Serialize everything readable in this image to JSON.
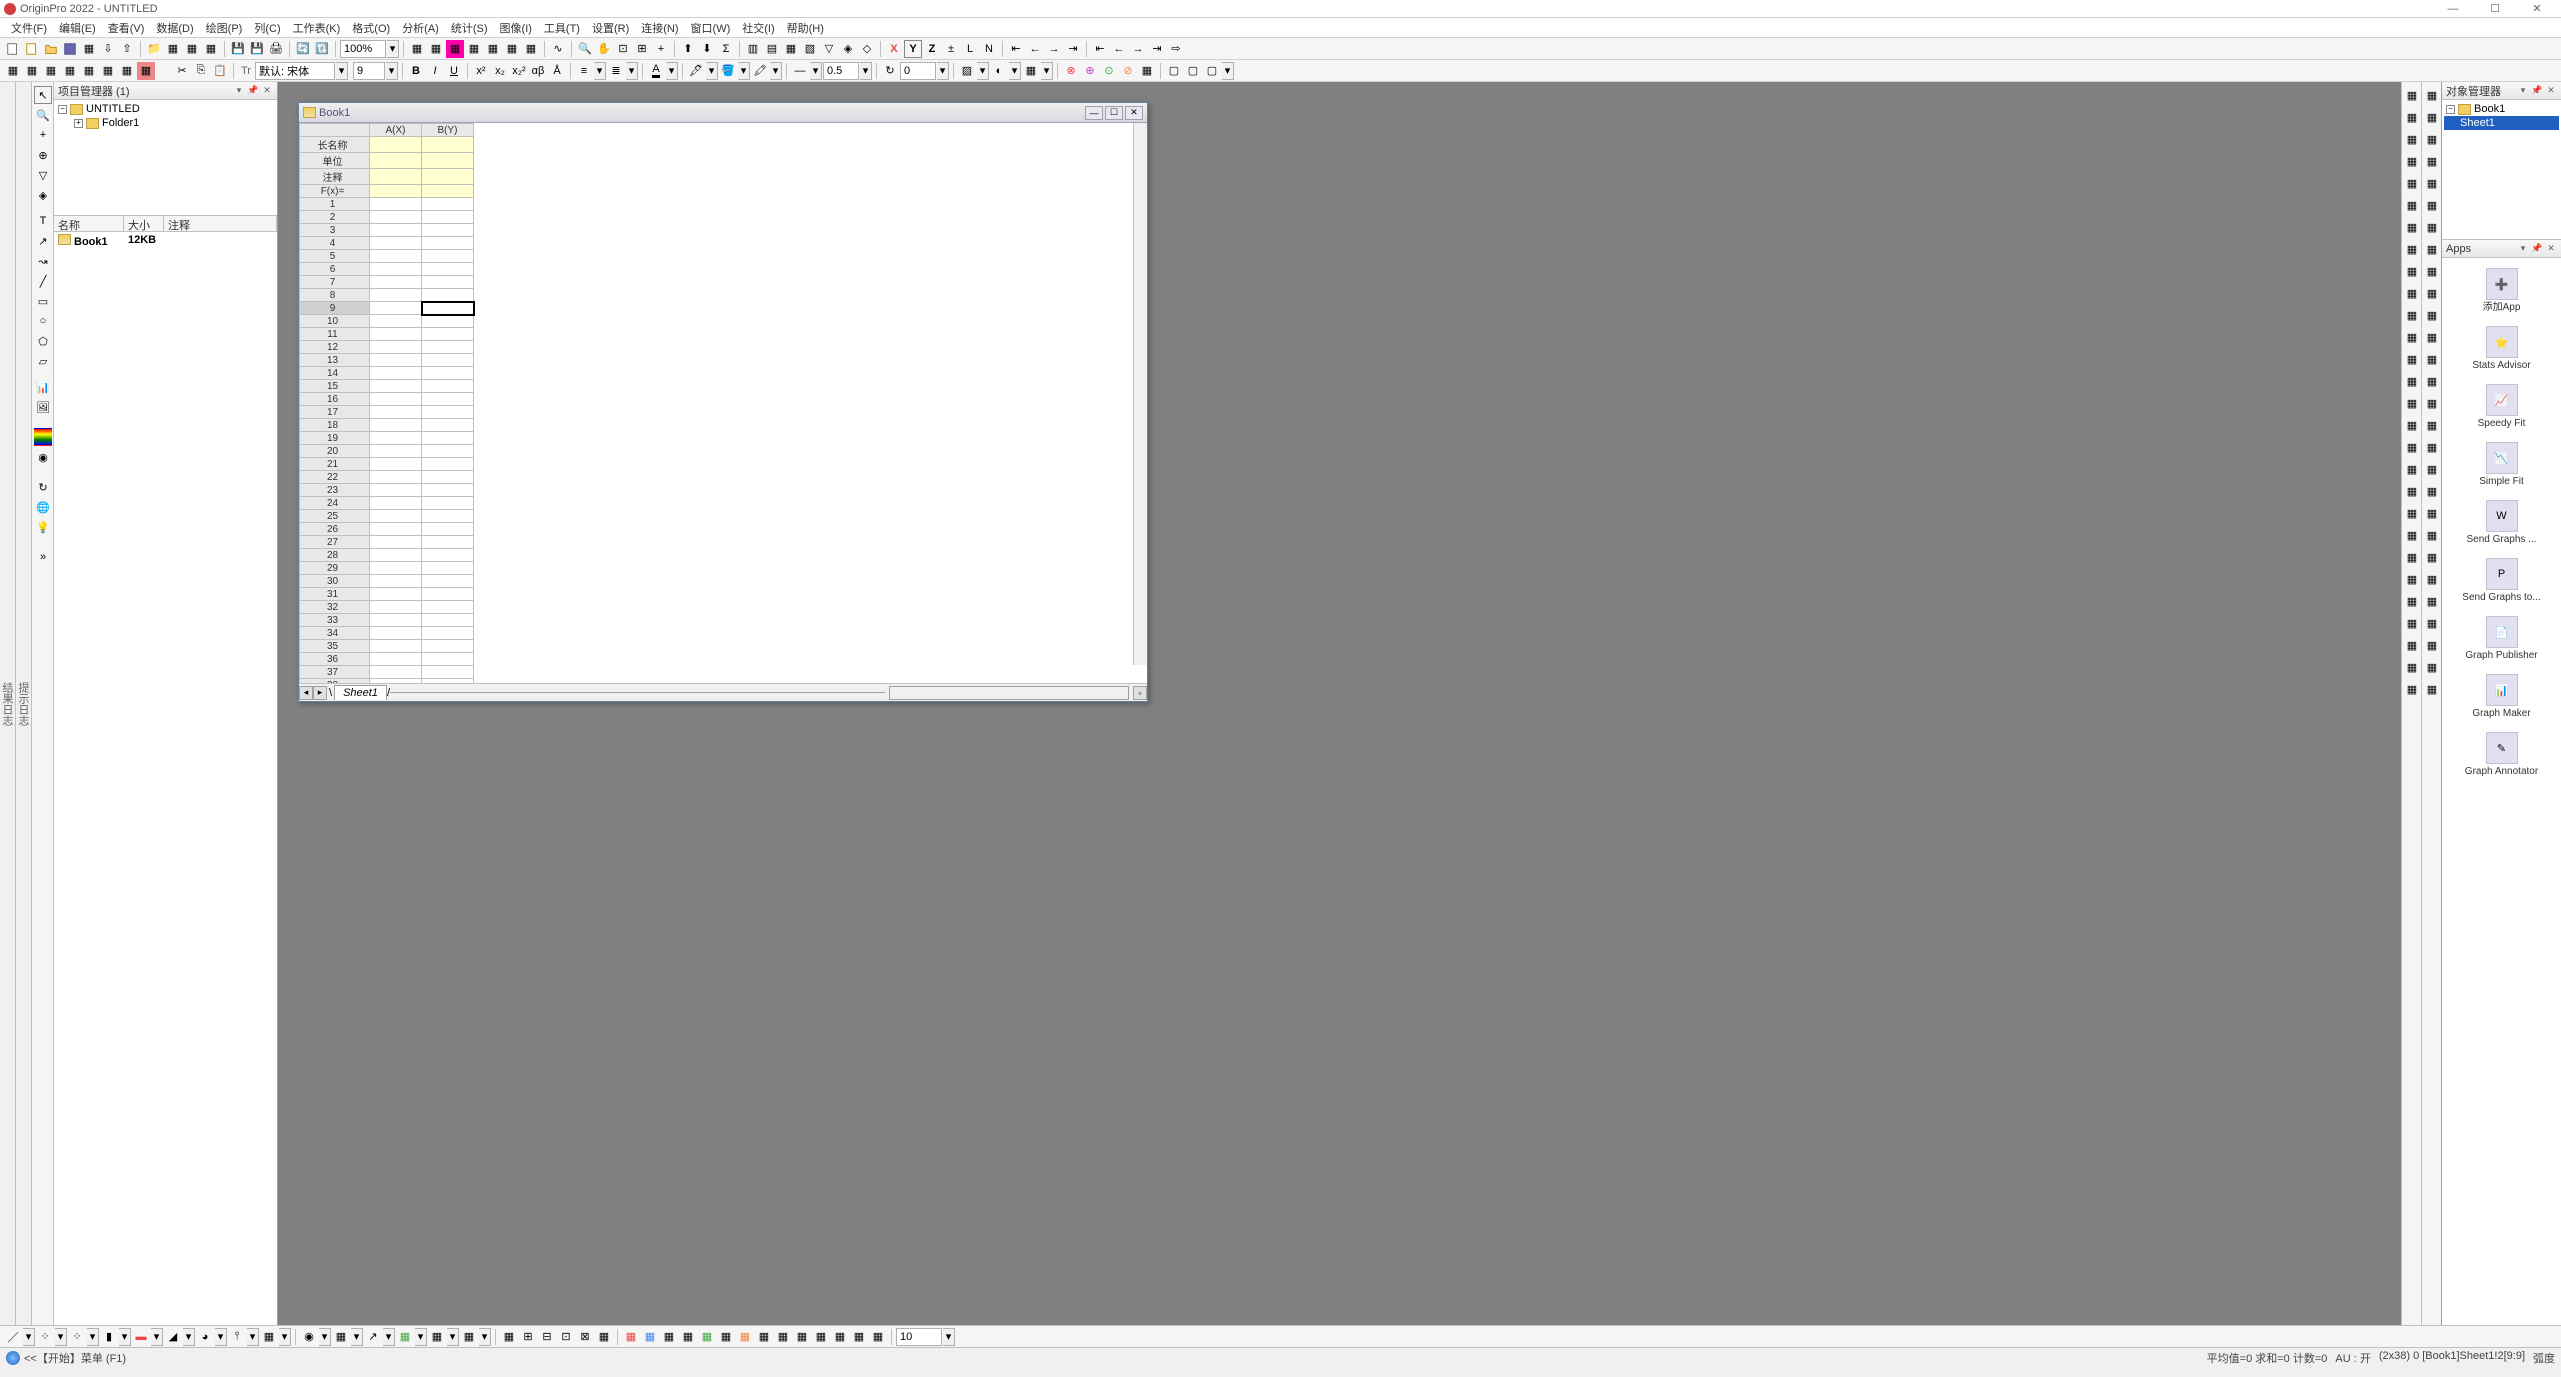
{
  "titlebar": {
    "app": "OriginPro 2022",
    "doc": "UNTITLED"
  },
  "menus": [
    "文件(F)",
    "编辑(E)",
    "查看(V)",
    "数据(D)",
    "绘图(P)",
    "列(C)",
    "工作表(K)",
    "格式(O)",
    "分析(A)",
    "统计(S)",
    "图像(I)",
    "工具(T)",
    "设置(R)",
    "连接(N)",
    "窗口(W)",
    "社交(I)",
    "帮助(H)"
  ],
  "toolbar1": {
    "zoom": "100%"
  },
  "toolbar2": {
    "fontLabel": "默认: 宋体",
    "fontSize": "9",
    "lineWidth": "0.5",
    "rotation": "0"
  },
  "projectPanel": {
    "title": "项目管理器 (1)",
    "tree": [
      {
        "label": "UNTITLED",
        "level": 0,
        "expanded": true
      },
      {
        "label": "Folder1",
        "level": 1,
        "expanded": false
      }
    ],
    "cols": {
      "name": "名称",
      "size": "大小",
      "comment": "注释"
    },
    "items": [
      {
        "name": "Book1",
        "size": "12KB",
        "comment": ""
      }
    ]
  },
  "book": {
    "title": "Book1",
    "cols": [
      "A(X)",
      "B(Y)"
    ],
    "labelRows": [
      "长名称",
      "单位",
      "注释",
      "F(x)="
    ],
    "numRows": 38,
    "selectedRow": 9,
    "selectedCol": 1,
    "sheetTab": "Sheet1"
  },
  "objectsPanel": {
    "title": "对象管理器",
    "tree": [
      {
        "label": "Book1",
        "level": 0
      },
      {
        "label": "Sheet1",
        "level": 1,
        "selected": true
      }
    ]
  },
  "appsPanel": {
    "title": "Apps",
    "items": [
      {
        "label": "添加App",
        "icon": "plus"
      },
      {
        "label": "Stats Advisor",
        "icon": "star"
      },
      {
        "label": "Speedy Fit",
        "icon": "fit"
      },
      {
        "label": "Simple Fit",
        "icon": "sfit"
      },
      {
        "label": "Send Graphs ...",
        "icon": "word"
      },
      {
        "label": "Send Graphs to...",
        "icon": "ppt"
      },
      {
        "label": "Graph Publisher",
        "icon": "pub"
      },
      {
        "label": "Graph Maker",
        "icon": "maker"
      },
      {
        "label": "Graph Annotator",
        "icon": "pen"
      }
    ]
  },
  "status": {
    "left": "<<【开始】菜单 (F1)",
    "stats": "平均值=0 求和=0 计数=0",
    "au": "AU : 开",
    "sel": "(2x38) 0  [Book1]Sheet1!2[9:9]",
    "unit": "弧度"
  },
  "bottomToolbar": {
    "input": "10"
  },
  "leftVLabels": [
    "结果日志",
    "提示日志"
  ]
}
